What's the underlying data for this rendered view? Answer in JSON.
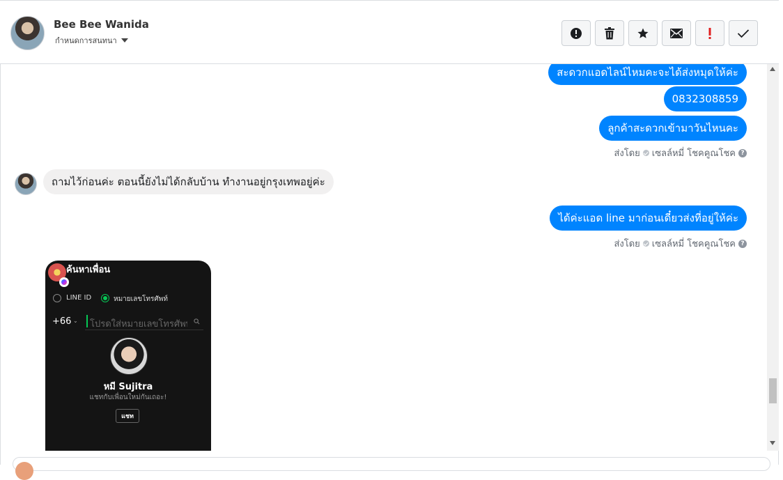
{
  "header": {
    "name": "Bee Bee Wanida",
    "assign_label": "กำหนดการสนทนา",
    "actions": [
      {
        "id": "spam",
        "icon": "alert-circle-icon"
      },
      {
        "id": "delete",
        "icon": "trash-icon"
      },
      {
        "id": "star",
        "icon": "star-icon"
      },
      {
        "id": "unread",
        "icon": "envelope-icon"
      },
      {
        "id": "important",
        "icon": "exclamation-icon",
        "color": "#e02020"
      },
      {
        "id": "done",
        "icon": "check-icon"
      }
    ]
  },
  "messages": {
    "out1": "สะดวกแอดไลน์ไหมคะจะได้ส่งหมุดให้ค่ะ",
    "out2": "0832308859",
    "out3": "ลูกค้าสะดวกเข้ามาวันไหนคะ",
    "sent_by_1": {
      "prefix": "ส่งโดย",
      "sender": "เซลล์หมี่ โชคคูณโชค"
    },
    "in1": "ถามไว้ก่อนค่ะ ตอนนี้ยังไม่ได้กลับบ้าน ทำงานอยู่กรุงเทพอยู่ค่ะ",
    "out4": "ได้ค่ะแอด line มาก่อนเดี๋ยวส่งที่อยู่ให้ค่ะ",
    "sent_by_2": {
      "prefix": "ส่งโดย",
      "sender": "เซลล์หมี่ โชคคูณโชค"
    }
  },
  "screenshot": {
    "title": "ค้นหาเพื่อน",
    "opt_line_id": "LINE ID",
    "opt_phone": "หมายเลขโทรศัพท์",
    "country_code": "+66",
    "phone_placeholder": "โปรดใส่หมายเลขโทรศัพท์",
    "friend_name": "หมี Sujitra",
    "friend_sub": "แชทกับเพื่อนใหม่กันเถอะ!",
    "chat_button": "แชท"
  },
  "colors": {
    "outgoing": "#0084ff",
    "incoming": "#f1f0f0",
    "line_green": "#06c755"
  }
}
